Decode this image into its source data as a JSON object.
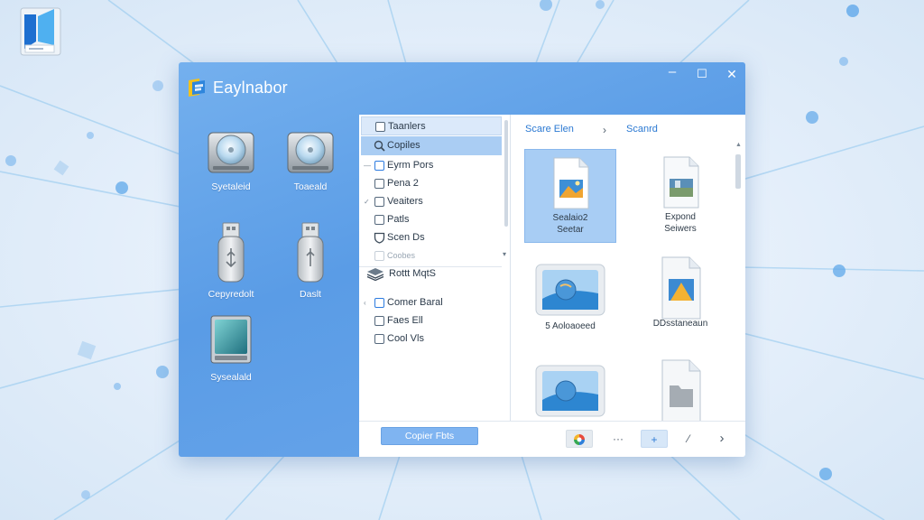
{
  "window": {
    "title": "Eaylnabor",
    "controls": {
      "minimize": "–",
      "maximize": "☐",
      "close": "✕"
    }
  },
  "drives": [
    {
      "label": "Syetaleid",
      "icon": "hard-drive-icon"
    },
    {
      "label": "Toaeald",
      "icon": "hard-drive-icon"
    },
    {
      "label": "Cepyredolt",
      "icon": "usb-drive-icon"
    },
    {
      "label": "Daslt",
      "icon": "usb-drive-icon"
    },
    {
      "label": "Sysealald",
      "icon": "ssd-drive-icon"
    }
  ],
  "sidebar": {
    "items": [
      {
        "label": "Taanlers",
        "kind": "header",
        "icon": "checkbox"
      },
      {
        "label": "Copiles",
        "kind": "selected",
        "icon": "search-icon"
      },
      {
        "label": "Eyrm Pors",
        "kind": "normal",
        "icon": "checkbox-blue"
      },
      {
        "label": "Pena 2",
        "kind": "normal",
        "icon": "checkbox"
      },
      {
        "label": "Veaiters",
        "kind": "normal",
        "icon": "checkbox"
      },
      {
        "label": "Patls",
        "kind": "normal",
        "icon": "checkbox"
      },
      {
        "label": "Scen Ds",
        "kind": "normal",
        "icon": "shield-icon"
      },
      {
        "label": "Coobes",
        "kind": "faded",
        "icon": "checkbox"
      },
      {
        "label": "Rottt MqtS",
        "kind": "normal",
        "icon": "layers-icon"
      },
      {
        "label": "Comer Baral",
        "kind": "normal",
        "icon": "checkbox-blue"
      },
      {
        "label": "Faes Ell",
        "kind": "normal",
        "icon": "checkbox"
      },
      {
        "label": "Cool Vls",
        "kind": "normal",
        "icon": "checkbox"
      }
    ]
  },
  "breadcrumb": {
    "items": [
      "Scare Elen",
      "Scanrd"
    ],
    "separator": "›"
  },
  "files": [
    {
      "name": "Sealaio2 Seetar",
      "selected": true,
      "thumb": "image-file-icon"
    },
    {
      "name": "Expond Seiwers",
      "selected": false,
      "thumb": "image-file-icon"
    },
    {
      "name": "5 Aoloaoeed",
      "selected": false,
      "thumb": "photo-icon"
    },
    {
      "name": "DDsstaneaun",
      "selected": false,
      "thumb": "pyramid-file-icon"
    },
    {
      "name": "",
      "selected": false,
      "thumb": "photo-icon"
    },
    {
      "name": "",
      "selected": false,
      "thumb": "folder-file-icon"
    }
  ],
  "footer": {
    "copy_button": "Copier Fbts",
    "more": "···",
    "add": "+",
    "edit": "⁄",
    "next": "›"
  },
  "colors": {
    "window_blue": "#5a9ce6",
    "selection_blue": "#a8cdf4",
    "link_blue": "#2a78d2",
    "button_blue": "#7fb4f1"
  }
}
